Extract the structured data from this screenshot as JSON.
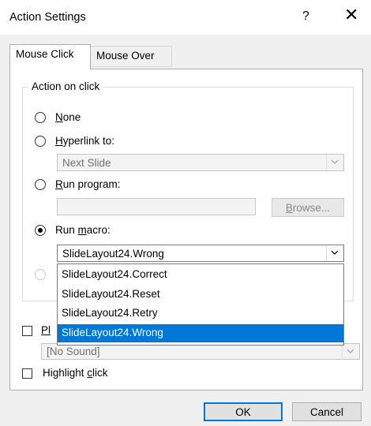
{
  "dialog": {
    "title": "Action Settings",
    "help_glyph": "?",
    "close_glyph": "✕"
  },
  "tabs": [
    {
      "label": "Mouse Click",
      "active": true
    },
    {
      "label": "Mouse Over",
      "active": false
    }
  ],
  "action_group": {
    "legend": "Action on click",
    "options": {
      "none": {
        "first": "N",
        "rest": "one",
        "checked": false
      },
      "hyperlink": {
        "first": "H",
        "rest": "yperlink to:",
        "checked": false
      },
      "run_program": {
        "first": "R",
        "rest": "un program:",
        "checked": false
      },
      "run_macro": {
        "before": "Run ",
        "u": "m",
        "rest": "acro:",
        "checked": true
      }
    },
    "hyperlink_value": "Next Slide",
    "program_value": "",
    "browse_label": "Browse...",
    "macro_value": "SlideLayout24.Wrong"
  },
  "macro_dropdown": {
    "items": [
      "SlideLayout24.Correct",
      "SlideLayout24.Reset",
      "SlideLayout24.Retry",
      "SlideLayout24.Wrong"
    ],
    "selected_index": 3
  },
  "play_sound": {
    "label_visible": "Pl",
    "checked": false,
    "sound_value": "[No Sound]"
  },
  "highlight": {
    "before": "Highlight ",
    "u": "c",
    "rest": "lick",
    "checked": false
  },
  "footer": {
    "ok_label": "OK",
    "cancel_label": "Cancel"
  },
  "colors": {
    "selection": "#0078d7",
    "dialog_bg": "#f0f0f0"
  }
}
